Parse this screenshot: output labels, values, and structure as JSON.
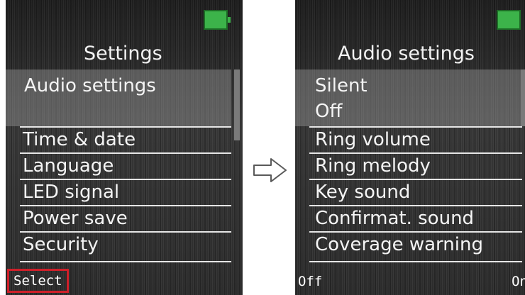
{
  "left_screen": {
    "title": "Settings",
    "items": [
      {
        "label": "Audio settings",
        "selected": true
      },
      {
        "label": "Time & date"
      },
      {
        "label": "Language"
      },
      {
        "label": "LED signal"
      },
      {
        "label": "Power save"
      },
      {
        "label": "Security"
      }
    ],
    "softkey_left": "Select"
  },
  "right_screen": {
    "title": "Audio settings",
    "items": [
      {
        "label": "Silent",
        "value": "Off",
        "selected": true
      },
      {
        "label": "Ring volume"
      },
      {
        "label": "Ring melody"
      },
      {
        "label": "Key sound"
      },
      {
        "label": "Confirmat. sound"
      },
      {
        "label": "Coverage warning"
      }
    ],
    "softkey_left": "Off",
    "softkey_right": "On"
  },
  "colors": {
    "battery": "#3cb34a",
    "highlight_box": "#d0202a",
    "screen_bg": "#2a2a2a"
  },
  "icons": [
    "battery-icon",
    "right-arrow-icon"
  ]
}
